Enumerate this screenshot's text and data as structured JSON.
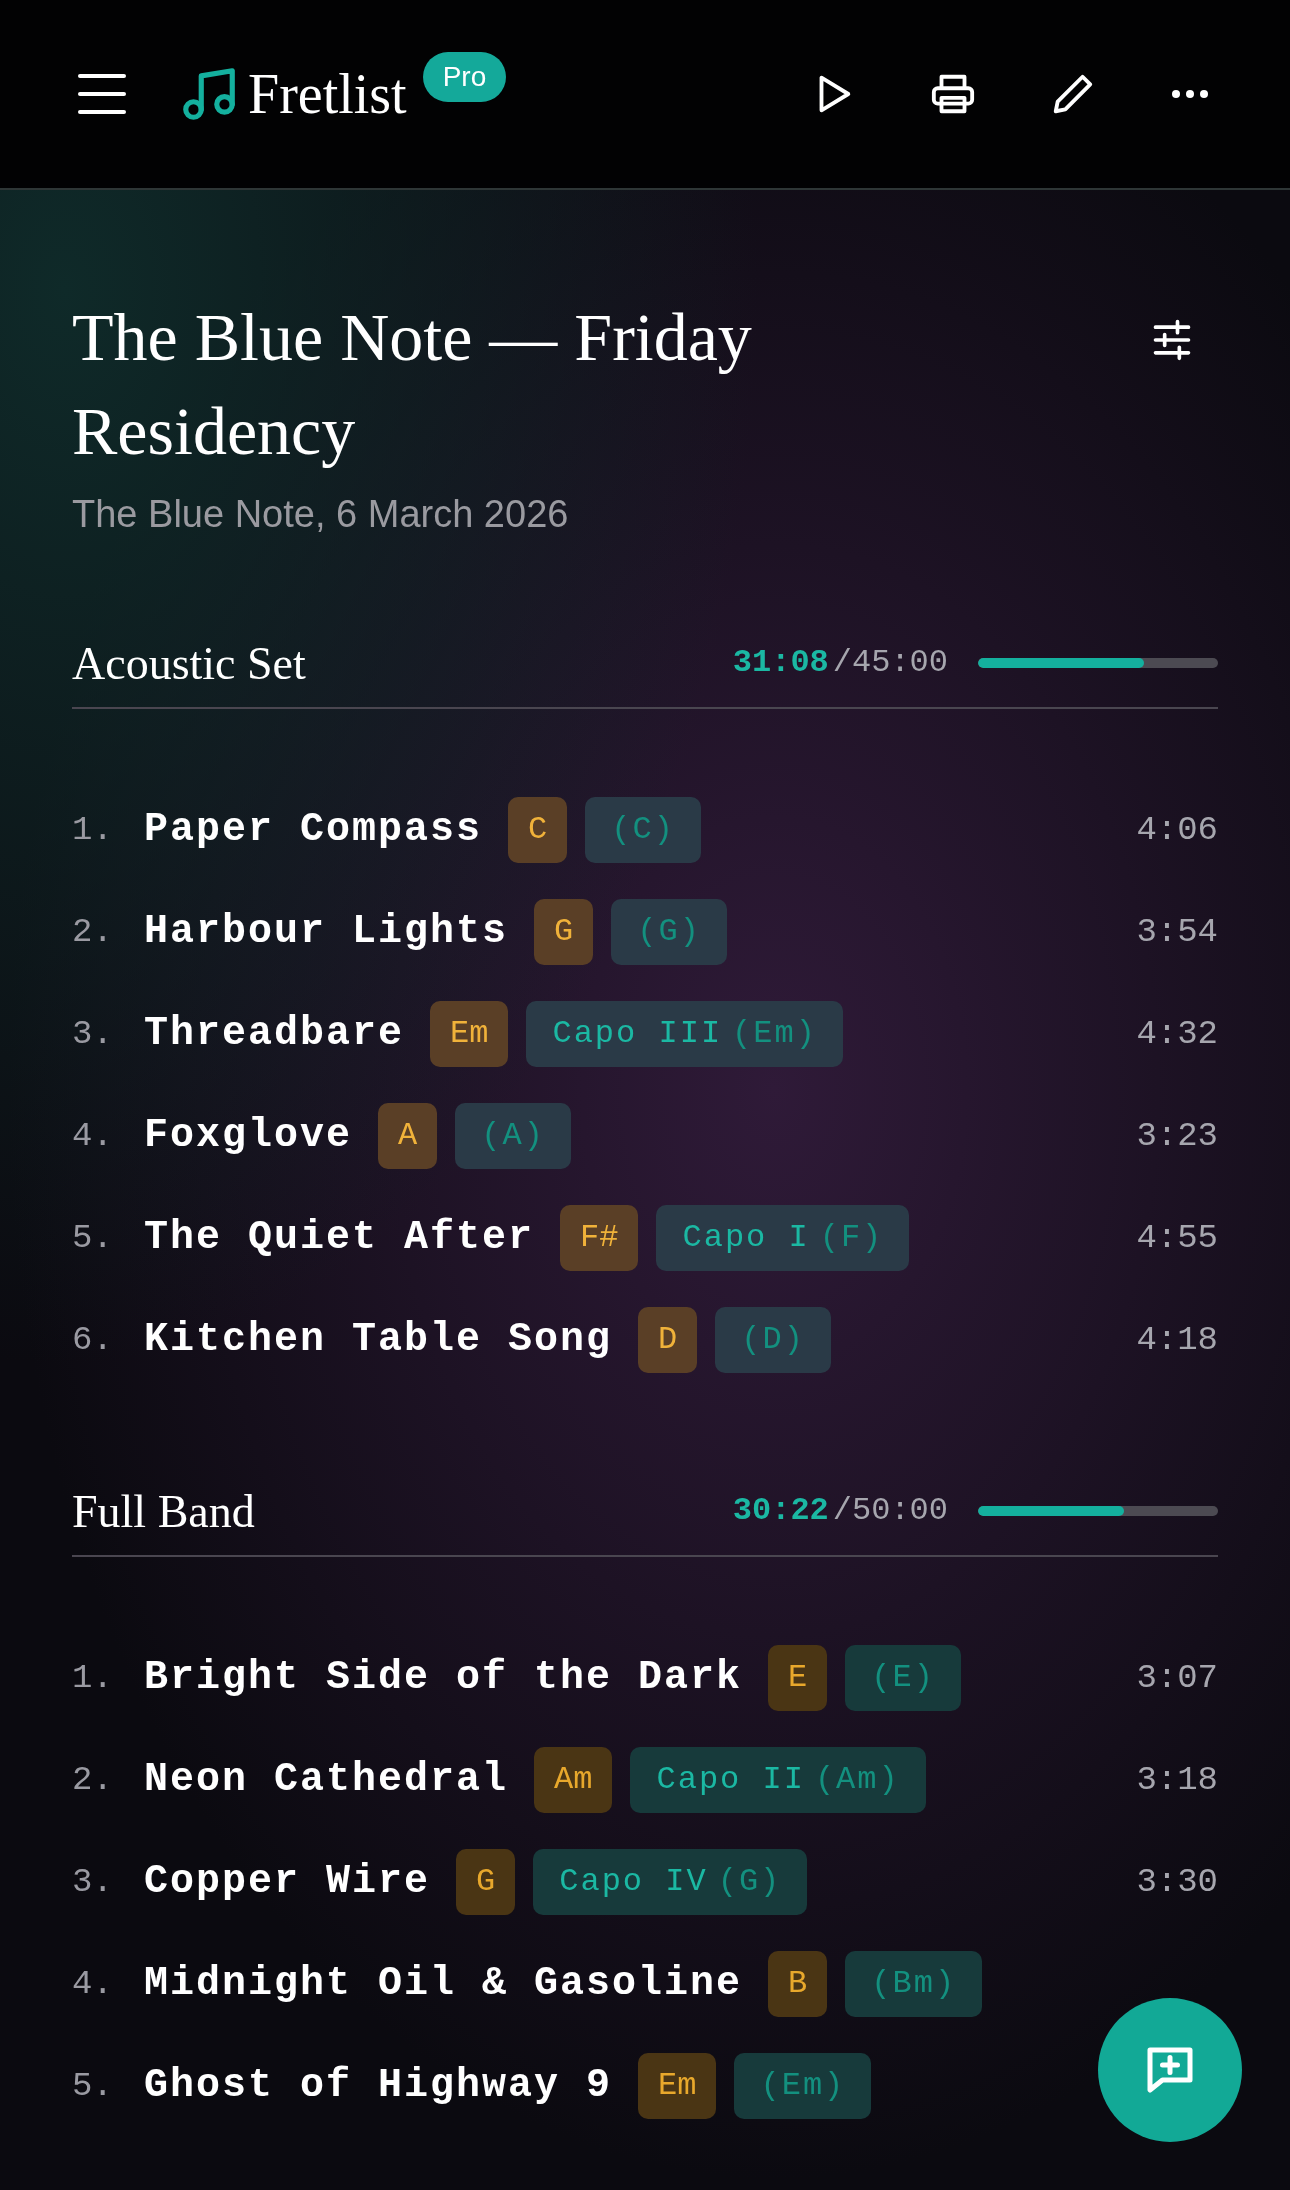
{
  "app": {
    "name": "Fretlist",
    "badge": "Pro"
  },
  "setlist": {
    "title": "The Blue Note — Friday Residency",
    "subtitle": "The Blue Note, 6 March 2026"
  },
  "sets": [
    {
      "name": "Acoustic Set",
      "kind": "acoustic",
      "elapsed": "31:08",
      "separator": "/",
      "total": "45:00",
      "level": 0.69,
      "songs": [
        {
          "number": "1.",
          "title": "Paper Compass",
          "key": "C",
          "shape": "(C)",
          "duration": "4:06"
        },
        {
          "number": "2.",
          "title": "Harbour Lights",
          "key": "G",
          "shape": "(G)",
          "duration": "3:54"
        },
        {
          "number": "3.",
          "title": "Threadbare",
          "key": "Em",
          "capo": "Capo III",
          "shape": "(Em)",
          "duration": "4:32"
        },
        {
          "number": "4.",
          "title": "Foxglove",
          "key": "A",
          "shape": "(A)",
          "duration": "3:23"
        },
        {
          "number": "5.",
          "title": "The Quiet After",
          "key": "F#",
          "capo": "Capo I",
          "shape": "(F)",
          "duration": "4:55"
        },
        {
          "number": "6.",
          "title": "Kitchen Table Song",
          "key": "D",
          "shape": "(D)",
          "duration": "4:18"
        }
      ]
    },
    {
      "name": "Full Band",
      "kind": "band",
      "elapsed": "30:22",
      "separator": "/",
      "total": "50:00",
      "level": 0.607,
      "songs": [
        {
          "number": "1.",
          "title": "Bright Side of the Dark",
          "key": "E",
          "shape": "(E)",
          "duration": "3:07"
        },
        {
          "number": "2.",
          "title": "Neon Cathedral",
          "key": "Am",
          "capo": "Capo II",
          "shape": "(Am)",
          "duration": "3:18"
        },
        {
          "number": "3.",
          "title": "Copper Wire",
          "key": "G",
          "capo": "Capo IV",
          "shape": "(G)",
          "duration": "3:30"
        },
        {
          "number": "4.",
          "title": "Midnight Oil & Gasoline",
          "key": "B",
          "shape": "(Bm)"
        },
        {
          "number": "5.",
          "title": "Ghost of Highway 9",
          "key": "Em",
          "shape": "(Em)"
        }
      ]
    }
  ]
}
